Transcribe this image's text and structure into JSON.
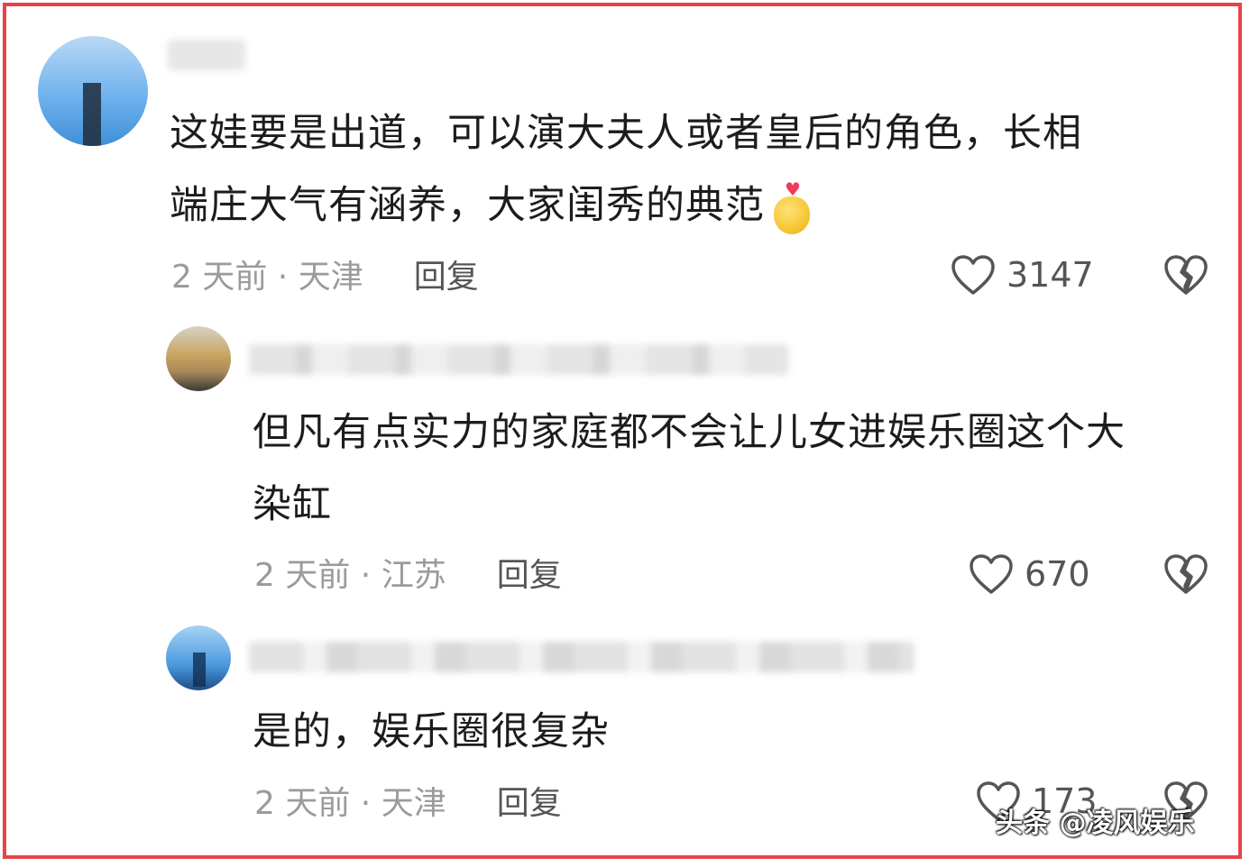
{
  "comments": [
    {
      "text_line1": "这娃要是出道，可以演大夫人或者皇后的角色，长相",
      "text_line2": "端庄大气有涵养，大家闺秀的典范",
      "time": "2 天前",
      "location": "天津",
      "reply": "回复",
      "likes": "3147",
      "emoji": "heart-hands-emoji"
    },
    {
      "text_line1": "但凡有点实力的家庭都不会让儿女进娱乐圈这个大",
      "text_line2": "染缸",
      "time": "2 天前",
      "location": "江苏",
      "reply": "回复",
      "likes": "670"
    },
    {
      "text_line1": "是的，娱乐圈很复杂",
      "time": "2 天前",
      "location": "天津",
      "reply": "回复",
      "likes": "173"
    }
  ],
  "separator": " · ",
  "icons": {
    "like": "heart-outline-icon",
    "dislike": "broken-heart-icon"
  },
  "watermark": "头条 @凌风娱乐",
  "colors": {
    "border": "#e8434a",
    "meta": "#9b9b9b",
    "text": "#1c1c1c"
  }
}
